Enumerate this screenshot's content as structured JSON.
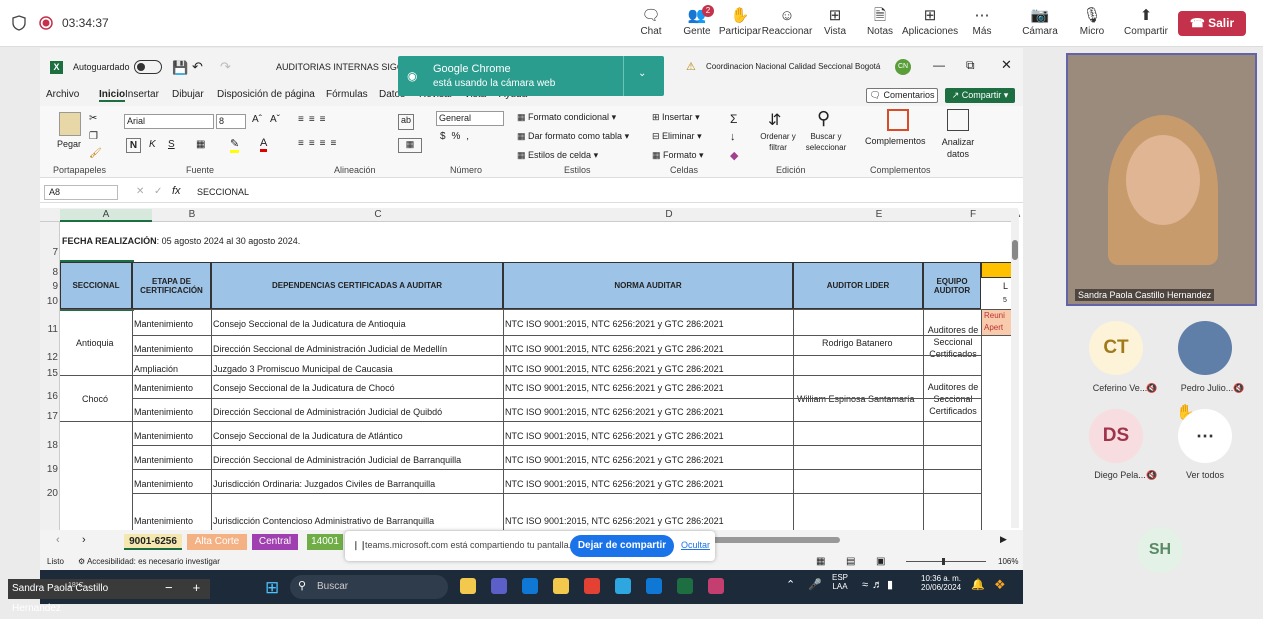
{
  "meeting": {
    "timer": "03:34:37",
    "leave_label": "Salir",
    "toolbar": [
      {
        "label": "Chat",
        "icon": "chat-icon",
        "badge": ""
      },
      {
        "label": "Gente",
        "icon": "people-icon",
        "badge": "2"
      },
      {
        "label": "Participar",
        "icon": "hand-icon",
        "badge": ""
      },
      {
        "label": "Reaccionar",
        "icon": "smile-icon",
        "badge": ""
      },
      {
        "label": "Vista",
        "icon": "grid-icon",
        "badge": ""
      },
      {
        "label": "Notas",
        "icon": "notes-icon",
        "badge": ""
      },
      {
        "label": "Aplicaciones",
        "icon": "plus-icon",
        "badge": ""
      },
      {
        "label": "Más",
        "icon": "more-icon",
        "badge": ""
      },
      {
        "label": "Cámara",
        "icon": "camera-off-icon",
        "badge": ""
      },
      {
        "label": "Micro",
        "icon": "mic-off-icon",
        "badge": ""
      },
      {
        "label": "Compartir",
        "icon": "share-icon",
        "badge": ""
      }
    ]
  },
  "excel": {
    "autosave": "Autoguardado",
    "filename": "AUDITORIAS INTERNAS SIGCMA",
    "sensitivity": "Coordinacion Nacional Calidad Seccional Bogotá",
    "user_initials": "CN",
    "menu": [
      "Archivo",
      "Inicio",
      "Insertar",
      "Dibujar",
      "Disposición de página",
      "Fórmulas",
      "Datos",
      "Revisar",
      "Vista",
      "Ayuda"
    ],
    "comments_label": "Comentarios",
    "share_label": "Compartir",
    "ribbon": {
      "paste": "Pegar",
      "font": "Arial",
      "size": "8",
      "bold": "N",
      "italic": "K",
      "underline": "S",
      "number_format": "General",
      "cond_format": "Formato condicional",
      "table_format": "Dar formato como tabla",
      "cell_styles": "Estilos de celda",
      "insert": "Insertar",
      "delete": "Eliminar",
      "format": "Formato",
      "sort": "Ordenar y filtrar",
      "find": "Buscar y seleccionar",
      "complements": "Complementos",
      "analyze": "Analizar datos",
      "groups": [
        "Portapapeles",
        "Fuente",
        "Alineación",
        "Número",
        "Estilos",
        "Celdas",
        "Edición",
        "Complementos"
      ]
    },
    "name_box": "A8",
    "formula": "SECCIONAL",
    "columns": [
      "A",
      "B",
      "C",
      "D",
      "E",
      "F",
      "A"
    ],
    "rows": [
      "7",
      "8",
      "9",
      "10",
      "11",
      "12",
      "15",
      "16",
      "17",
      "18",
      "19",
      "20"
    ],
    "fecha_label": "FECHA REALIZACIÓN",
    "fecha_value": ": 05 agosto 2024 al 30 agosto 2024.",
    "headers": [
      "SECCIONAL",
      "ETAPA DE CERTIFICACIÓN",
      "DEPENDENCIAS CERTIFICADAS A AUDITAR",
      "NORMA AUDITAR",
      "AUDITOR LIDER",
      "EQUIPO AUDITOR"
    ],
    "hdr_extra": [
      "L",
      "5"
    ],
    "data": [
      {
        "etapa": "Mantenimiento",
        "dep": "Consejo Seccional de la Judicatura de Antioquia",
        "norma": "NTC ISO 9001:2015, NTC 6256:2021 y GTC 286:2021"
      },
      {
        "etapa": "Mantenimiento",
        "dep": "Dirección Seccional de Administración Judicial de  Medellín",
        "norma": "NTC ISO 9001:2015, NTC 6256:2021 y GTC 286:2021"
      },
      {
        "etapa": "Ampliación",
        "dep": "Juzgado 3 Promiscuo Municipal de Caucasia",
        "norma": "NTC ISO 9001:2015, NTC 6256:2021 y GTC 286:2021"
      },
      {
        "etapa": "Mantenimiento",
        "dep": "Consejo Seccional de la Judicatura de Chocó",
        "norma": "NTC ISO 9001:2015, NTC 6256:2021 y GTC 286:2021"
      },
      {
        "etapa": "Mantenimiento",
        "dep": "Dirección Seccional de Administración Judicial de Quibdó",
        "norma": "NTC ISO 9001:2015, NTC 6256:2021 y GTC 286:2021"
      },
      {
        "etapa": "Mantenimiento",
        "dep": "Consejo Seccional de la Judicatura de  Atlántico",
        "norma": "NTC ISO 9001:2015, NTC 6256:2021 y GTC 286:2021"
      },
      {
        "etapa": "Mantenimiento",
        "dep": "Dirección Seccional de Administración Judicial de  Barranquilla",
        "norma": "NTC ISO 9001:2015, NTC 6256:2021 y GTC 286:2021"
      },
      {
        "etapa": "Mantenimiento",
        "dep": "Jurisdicción Ordinaria: Juzgados Civiles de Barranquilla",
        "norma": "NTC ISO 9001:2015, NTC 6256:2021 y GTC 286:2021"
      },
      {
        "etapa": "Mantenimiento",
        "dep": "Jurisdicción Contencioso Administrativo de Barranquilla",
        "norma": "NTC ISO 9001:2015, NTC 6256:2021 y GTC 286:2021"
      }
    ],
    "seccionales": [
      "Antioquia",
      "Chocó"
    ],
    "auditores": [
      "Rodrigo Batanero",
      "William Espinosa Santamaría"
    ],
    "equipo": "Auditores de Seccional Certificados",
    "orange_note": [
      "Reuni",
      "Apert"
    ],
    "sheet_tabs": [
      {
        "label": "9001-6256",
        "color": "#f4e7b0"
      },
      {
        "label": "Alta Corte",
        "color": "#f4b183"
      },
      {
        "label": "Central",
        "color": "#9f3fb0"
      },
      {
        "label": "14001",
        "color": "#70ad47"
      }
    ],
    "status_ready": "Listo",
    "status_access": "Accesibilidad: es necesario investigar",
    "zoom": "106%"
  },
  "notification": {
    "title": "Google Chrome",
    "body": "está usando la cámara web"
  },
  "share_bar": {
    "text": "teams.microsoft.com está compartiendo tu pantalla.",
    "stop": "Dejar de compartir",
    "hide": "Ocultar"
  },
  "panel": {
    "presenter": "Sandra Paola Castillo Hernandez",
    "participants": [
      {
        "initials": "CT",
        "name": "Ceferino Ve...",
        "bg": "#fdf3d8",
        "fg": "#a07b1a"
      },
      {
        "initials": "",
        "name": "Pedro Julio...",
        "bg": "#5f7fa8",
        "fg": "#fff"
      },
      {
        "initials": "DS",
        "name": "Diego Pela...",
        "bg": "#f7dce0",
        "fg": "#a0344b"
      }
    ],
    "see_all": "Ver todos",
    "sh": "SH"
  },
  "taskbar": {
    "search": "Buscar",
    "weather": "18°C",
    "lang1": "ESP",
    "lang2": "LAA",
    "time": "10:36 a. m.",
    "date": "20/06/2024",
    "pip_name": "Sandra Paola Castillo Hernandez"
  }
}
